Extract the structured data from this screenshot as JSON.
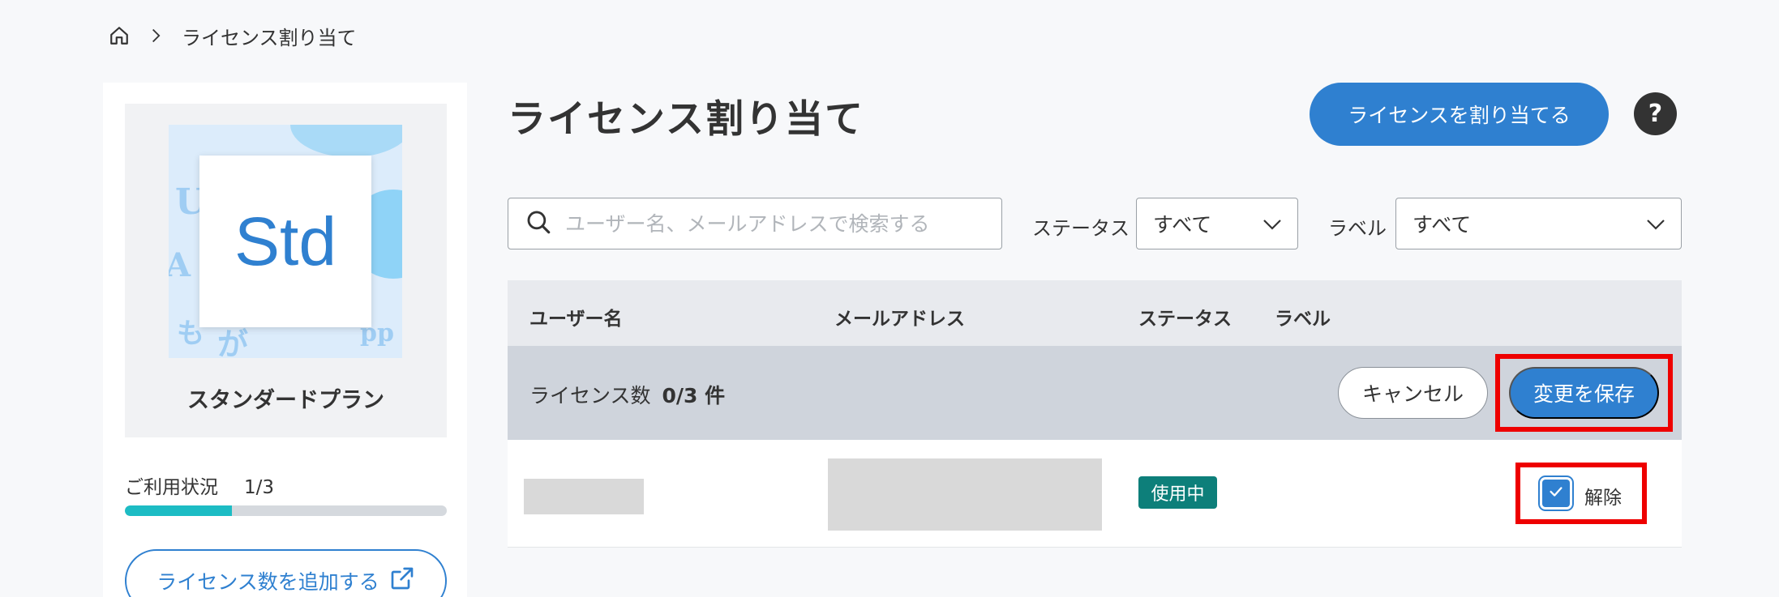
{
  "breadcrumb": {
    "current": "ライセンス割り当て"
  },
  "sidebar": {
    "plan_logo_text": "Std",
    "plan_name": "スタンダードプラン",
    "usage_label": "ご利用状況",
    "usage_value": "1/3",
    "usage_fraction": 0.333,
    "add_button_label": "ライセンス数を追加する"
  },
  "header": {
    "title": "ライセンス割り当て",
    "assign_button_label": "ライセンスを割り当てる",
    "help_label": "?"
  },
  "filters": {
    "search_placeholder": "ユーザー名、メールアドレスで検索する",
    "status_label": "ステータス",
    "status_value": "すべて",
    "label_label": "ラベル",
    "label_value": "すべて"
  },
  "table": {
    "columns": [
      "ユーザー名",
      "メールアドレス",
      "ステータス",
      "ラベル"
    ],
    "count_label": "ライセンス数",
    "count_value": "0/3 件",
    "cancel_label": "キャンセル",
    "save_label": "変更を保存",
    "rows": [
      {
        "status": "使用中",
        "action_label": "解除",
        "checked": true
      }
    ]
  },
  "colors": {
    "accent": "#2f80d0",
    "progress": "#1dbcc4",
    "status_badge": "#0d7f7a",
    "highlight": "#ee0000"
  }
}
